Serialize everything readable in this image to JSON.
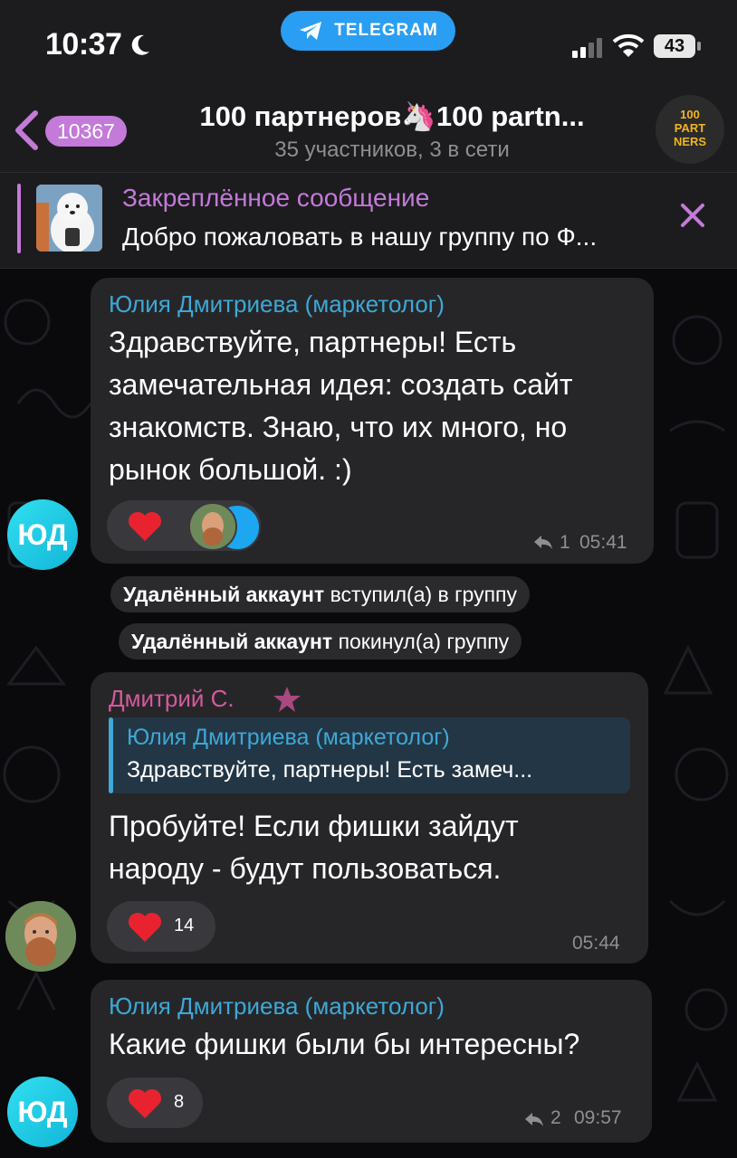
{
  "status_bar": {
    "time": "10:37",
    "telegram_pill": "TELEGRAM",
    "battery": "43"
  },
  "header": {
    "unread_count": "10367",
    "title": "100 партнеров🦄100 partn...",
    "subtitle": "35 участников, 3 в сети",
    "avatar_line1": "100",
    "avatar_line2": "PART",
    "avatar_line3": "NERS"
  },
  "pinned": {
    "title": "Закреплённое сообщение",
    "text": "Добро пожаловать в нашу группу по Ф..."
  },
  "messages": [
    {
      "sender": "Юлия Дмитриева (маркетолог)",
      "sender_color": "#3ea8d6",
      "lines": [
        "Здравствуйте, партнеры! Есть",
        "замечательная идея: создать сайт",
        "знакомств. Знаю, что их много, но",
        "рынок большой. :)"
      ],
      "reaction": "heart",
      "replies": "1",
      "time": "05:41",
      "avatar_initials": "ЮД"
    },
    {
      "sender": "Дмитрий С.",
      "sender_color": "#d35a9b",
      "reply_to_name": "Юлия Дмитриева (маркетолог)",
      "reply_to_text": "Здравствуйте, партнеры! Есть замеч...",
      "lines": [
        "Пробуйте! Если фишки зайдут",
        "народу - будут пользоваться."
      ],
      "reaction_count": "14",
      "time": "05:44"
    },
    {
      "sender": "Юлия Дмитриева (маркетолог)",
      "sender_color": "#3ea8d6",
      "lines": [
        "Какие фишки были бы интересны?"
      ],
      "reaction_count": "8",
      "replies": "2",
      "time": "09:57",
      "avatar_initials": "ЮД"
    }
  ],
  "service_messages": [
    {
      "name": "Удалённый аккаунт",
      "action": "вступил(а) в группу"
    },
    {
      "name": "Удалённый аккаунт",
      "action": "покинул(а) группу"
    }
  ],
  "colors": {
    "accent_purple": "#c37ad8",
    "telegram_blue": "#2a9ef2",
    "reaction_red": "#e8232f"
  }
}
